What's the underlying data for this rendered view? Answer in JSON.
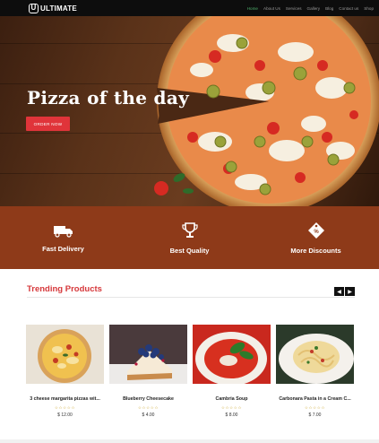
{
  "brand": {
    "logo_letter": "U",
    "name": "ULTIMATE"
  },
  "nav": {
    "items": [
      "Home",
      "About Us",
      "Services",
      "Gallery",
      "Blog",
      "Contact us",
      "Shop"
    ],
    "active_index": 0,
    "active_color": "#4fb06d"
  },
  "hero": {
    "title": "Pizza of the day",
    "button": "ORDER NOW",
    "button_color": "#e0343a"
  },
  "features": [
    {
      "label": "Fast Delivery",
      "icon": "truck-icon"
    },
    {
      "label": "Best Quality",
      "icon": "trophy-icon"
    },
    {
      "label": "More Discounts",
      "icon": "discount-tag-icon"
    }
  ],
  "features_bg": "#8e3a19",
  "trending": {
    "title": "Trending Products",
    "prev": "◀",
    "next": "▶",
    "products": [
      {
        "name": "3 cheese margarita pizzas wit...",
        "stars": "☆☆☆☆☆",
        "price": "$ 12.00",
        "image": "pizza"
      },
      {
        "name": "Blueberry Cheesecake",
        "stars": "☆☆☆☆☆",
        "price": "$ 4.00",
        "image": "cheesecake"
      },
      {
        "name": "Cambria Soup",
        "stars": "☆☆☆☆☆",
        "price": "$ 8.00",
        "image": "soup"
      },
      {
        "name": "Carbonara Pasta in a Cream C...",
        "stars": "☆☆☆☆☆",
        "price": "$ 7.00",
        "image": "pasta"
      }
    ]
  }
}
